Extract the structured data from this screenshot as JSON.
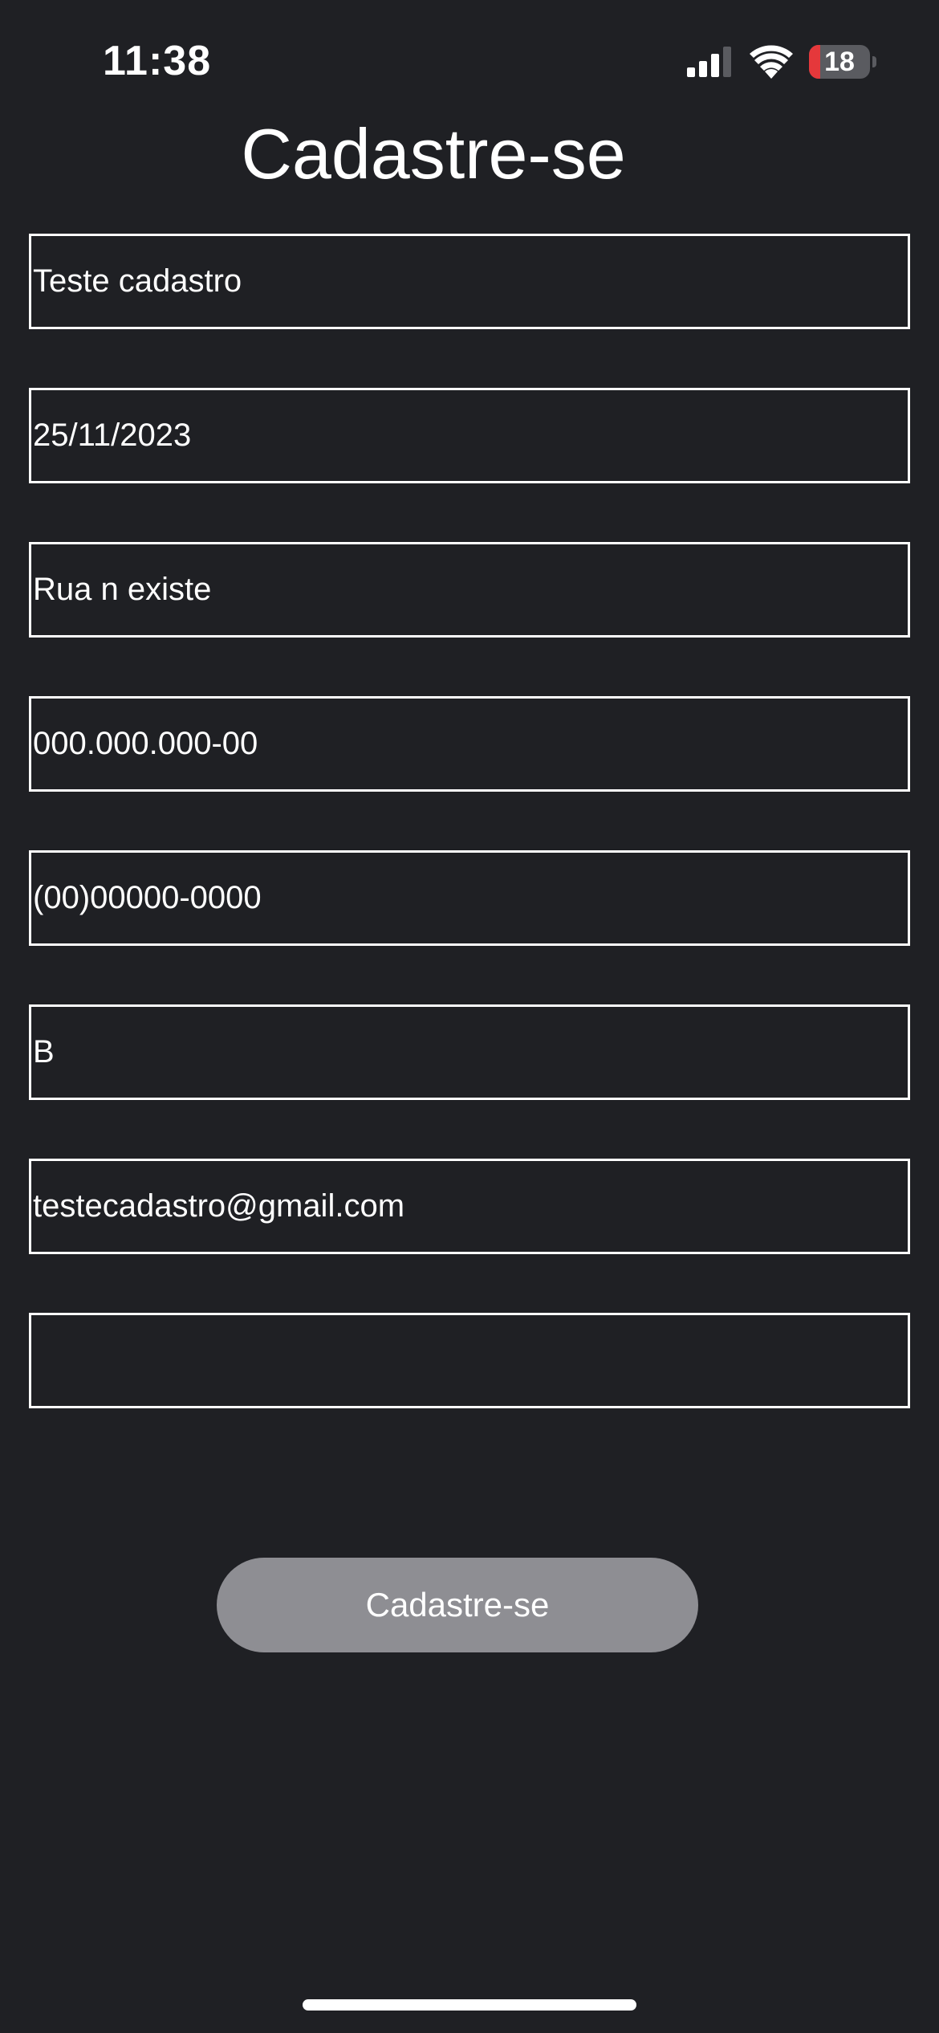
{
  "status_bar": {
    "time": "11:38",
    "battery_level": "18",
    "signal_icon": "cellular-signal-icon",
    "wifi_icon": "wifi-icon",
    "battery_icon": "battery-icon"
  },
  "title": "Cadastre-se",
  "form": {
    "fields": [
      {
        "value": "Teste cadastro",
        "placeholder": ""
      },
      {
        "value": "25/11/2023",
        "placeholder": ""
      },
      {
        "value": "Rua n existe",
        "placeholder": ""
      },
      {
        "value": "000.000.000-00",
        "placeholder": ""
      },
      {
        "value": "(00)00000-0000",
        "placeholder": ""
      },
      {
        "value": "B",
        "placeholder": ""
      },
      {
        "value": "testecadastro@gmail.com",
        "placeholder": ""
      },
      {
        "value": "",
        "placeholder": ""
      }
    ],
    "submit_label": "Cadastre-se"
  },
  "colors": {
    "background": "#1f2024",
    "text": "#ffffff",
    "field_border": "#ffffff",
    "button_background": "#8e8e93",
    "battery_low": "#e5383b"
  }
}
